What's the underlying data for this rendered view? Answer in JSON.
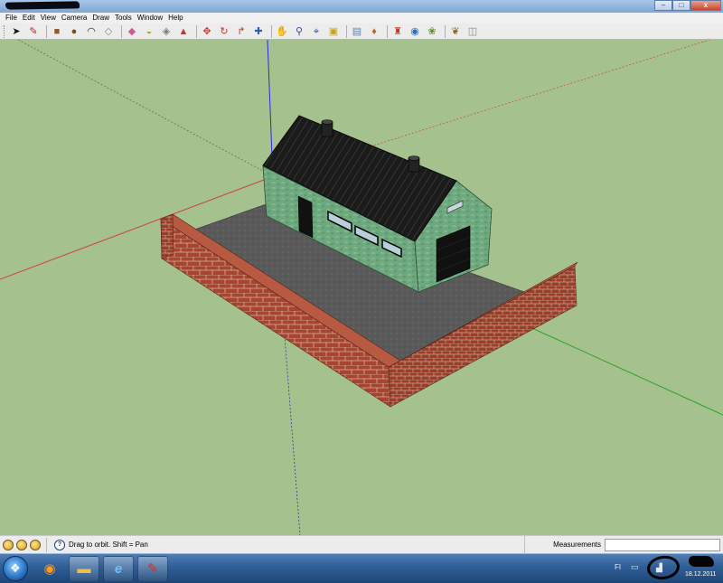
{
  "menu": [
    "File",
    "Edit",
    "View",
    "Camera",
    "Draw",
    "Tools",
    "Window",
    "Help"
  ],
  "window_controls": {
    "minimize": "–",
    "maximize": "□",
    "close": "x"
  },
  "toolbar": [
    {
      "name": "select-tool-icon",
      "glyph": "➤",
      "color": "#111111"
    },
    {
      "name": "pencil-tool-icon",
      "glyph": "✎",
      "color": "#b3262b"
    },
    {
      "name": "rectangle-tool-icon",
      "glyph": "■",
      "color": "#8a5a2b"
    },
    {
      "name": "circle-tool-icon",
      "glyph": "●",
      "color": "#7a4f24"
    },
    {
      "name": "arc-tool-icon",
      "glyph": "◠",
      "color": "#2a2a2a"
    },
    {
      "name": "make-component-icon",
      "glyph": "◇",
      "color": "#888888"
    },
    {
      "name": "eraser-tool-icon",
      "glyph": "◆",
      "color": "#d25a8f"
    },
    {
      "name": "tape-measure-icon",
      "glyph": "◒",
      "color": "#c9a317"
    },
    {
      "name": "paint-bucket-icon",
      "glyph": "◈",
      "color": "#7a7a7a"
    },
    {
      "name": "push-pull-icon",
      "glyph": "▲",
      "color": "#c0392b"
    },
    {
      "name": "move-tool-icon",
      "glyph": "✥",
      "color": "#c0392b"
    },
    {
      "name": "rotate-tool-icon",
      "glyph": "↻",
      "color": "#c0392b"
    },
    {
      "name": "follow-me-icon",
      "glyph": "↱",
      "color": "#c0392b"
    },
    {
      "name": "orbit-tool-icon",
      "glyph": "✚",
      "color": "#2a5fb0"
    },
    {
      "name": "pan-tool-icon",
      "glyph": "✋",
      "color": "#666666"
    },
    {
      "name": "zoom-tool-icon",
      "glyph": "⚲",
      "color": "#2a4f8f"
    },
    {
      "name": "zoom-extents-icon",
      "glyph": "⌖",
      "color": "#2a4f8f"
    },
    {
      "name": "get-models-icon",
      "glyph": "▣",
      "color": "#c9a317"
    },
    {
      "name": "share-model-icon",
      "glyph": "▤",
      "color": "#5a7fb0"
    },
    {
      "name": "components-icon",
      "glyph": "♦",
      "color": "#b36b2b"
    },
    {
      "name": "extension-warehouse-icon",
      "glyph": "♜",
      "color": "#c0392b"
    },
    {
      "name": "google-earth-icon",
      "glyph": "◉",
      "color": "#2a6fc0"
    },
    {
      "name": "photo-textures-icon",
      "glyph": "❀",
      "color": "#5a8f2a"
    },
    {
      "name": "styles-icon",
      "glyph": "❦",
      "color": "#8f6a2a"
    },
    {
      "name": "layout-icon",
      "glyph": "◫",
      "color": "#888888"
    }
  ],
  "status": {
    "hint": "Drag to orbit.  Shift = Pan",
    "measurements_label": "Measurements",
    "measurements_value": ""
  },
  "tray": {
    "lang": "FI",
    "date": "18.12.2011"
  }
}
